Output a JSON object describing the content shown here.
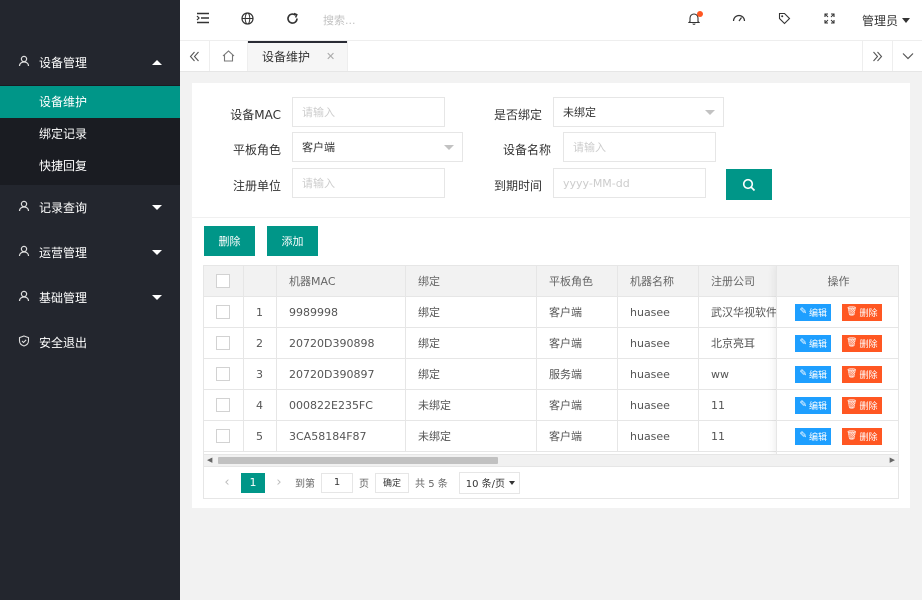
{
  "header": {
    "search_placeholder": "搜索...",
    "admin_label": "管理员"
  },
  "sidebar": {
    "groups": [
      {
        "label": "设备管理",
        "icon": "user-icon",
        "expanded": true,
        "items": [
          {
            "label": "设备维护",
            "active": true
          },
          {
            "label": "绑定记录"
          },
          {
            "label": "快捷回复"
          }
        ]
      },
      {
        "label": "记录查询",
        "icon": "user-icon"
      },
      {
        "label": "运营管理",
        "icon": "user-icon"
      },
      {
        "label": "基础管理",
        "icon": "user-icon"
      },
      {
        "label": "安全退出",
        "icon": "shield-icon"
      }
    ]
  },
  "tabs": {
    "active_label": "设备维护"
  },
  "form": {
    "mac_label": "设备MAC",
    "mac_placeholder": "请输入",
    "bound_label": "是否绑定",
    "bound_value": "未绑定",
    "role_label": "平板角色",
    "role_value": "客户端",
    "name_label": "设备名称",
    "name_placeholder": "请输入",
    "unit_label": "注册单位",
    "unit_placeholder": "请输入",
    "expire_label": "到期时间",
    "expire_placeholder": "yyyy-MM-dd"
  },
  "toolbar": {
    "delete_label": "删除",
    "add_label": "添加"
  },
  "table": {
    "columns": [
      "",
      "",
      "机器MAC",
      "绑定",
      "平板角色",
      "机器名称",
      "注册公司"
    ],
    "action_header": "操作",
    "edit_label": "编辑",
    "delete_label": "删除",
    "rows": [
      [
        "1",
        "9989998",
        "绑定",
        "客户端",
        "huasee",
        "武汉华视软件"
      ],
      [
        "2",
        "20720D390898",
        "绑定",
        "客户端",
        "huasee",
        "北京亮耳"
      ],
      [
        "3",
        "20720D390897",
        "绑定",
        "服务端",
        "huasee",
        "ww"
      ],
      [
        "4",
        "000822E235FC",
        "未绑定",
        "客户端",
        "huasee",
        "11"
      ],
      [
        "5",
        "3CA58184F87",
        "未绑定",
        "客户端",
        "huasee",
        "11"
      ]
    ]
  },
  "pager": {
    "current_page": "1",
    "goto_label": "到第",
    "page_input": "1",
    "page_unit": "页",
    "confirm_label": "确定",
    "total_label": "共 5 条",
    "page_size": "10 条/页"
  },
  "colors": {
    "sidebar_bg": "#23262e",
    "accent": "#009688",
    "edit_btn": "#1e9fff",
    "delete_btn": "#ff5722"
  }
}
